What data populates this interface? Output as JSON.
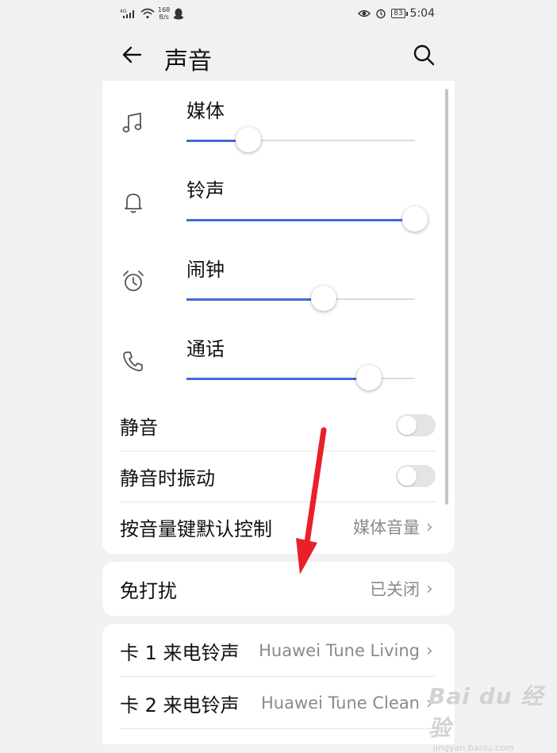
{
  "status_bar": {
    "signal_text": "4G",
    "speed_value": "168",
    "speed_unit": "B/s",
    "battery": "83",
    "time": "5:04"
  },
  "header": {
    "title": "声音",
    "back_icon": "arrow-left-icon",
    "search_icon": "search-icon"
  },
  "volumes": [
    {
      "label": "媒体",
      "icon": "music-note-icon",
      "level": 0.27
    },
    {
      "label": "铃声",
      "icon": "bell-icon",
      "level": 1.0
    },
    {
      "label": "闹钟",
      "icon": "alarm-clock-icon",
      "level": 0.6
    },
    {
      "label": "通话",
      "icon": "phone-icon",
      "level": 0.8
    }
  ],
  "toggles": {
    "mute": {
      "label": "静音",
      "on": false
    },
    "vibrate_on_mute": {
      "label": "静音时振动",
      "on": false
    }
  },
  "volume_key": {
    "label": "按音量键默认控制",
    "value": "媒体音量"
  },
  "dnd": {
    "label": "免打扰",
    "value": "已关闭"
  },
  "ringtones": [
    {
      "label": "卡 1 来电铃声",
      "value": "Huawei Tune Living"
    },
    {
      "label": "卡 2 来电铃声",
      "value": "Huawei Tune Clean"
    }
  ],
  "annotation_color": "#e8202a",
  "accent_color": "#4868d8",
  "watermark": {
    "logo": "Bai du 经验",
    "url": "jingyan.baidu.com"
  }
}
